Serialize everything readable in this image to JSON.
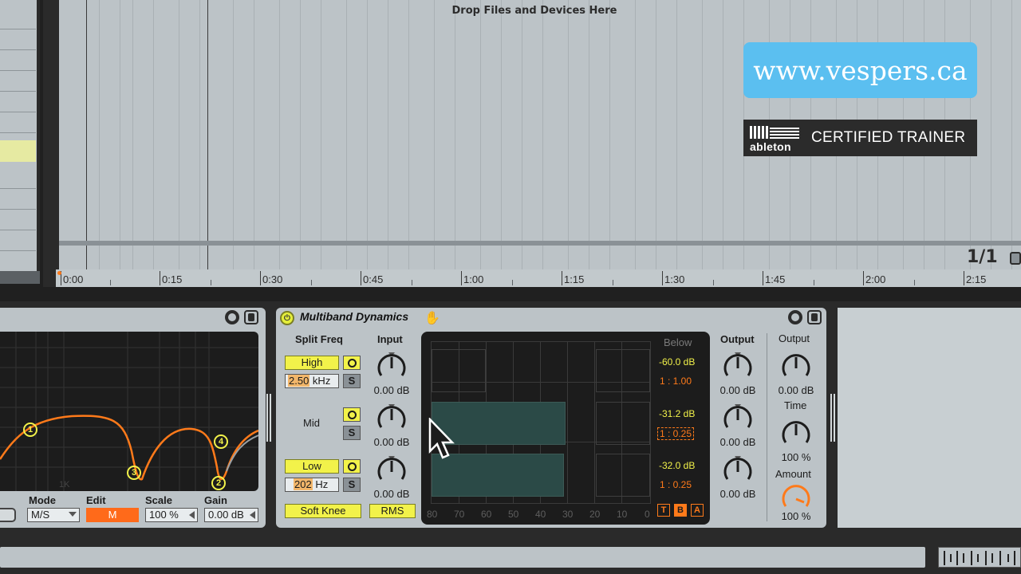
{
  "arrangement": {
    "drop_hint": "Drop Files and Devices Here",
    "loop_count": "1/1",
    "ruler_labels": [
      "0:00",
      "0:15",
      "0:30",
      "0:45",
      "1:00",
      "1:15",
      "1:30",
      "1:45",
      "2:00",
      "2:15"
    ]
  },
  "branding": {
    "website": "www.vespers.ca",
    "logo_word": "ableton",
    "certified": "CERTIFIED TRAINER"
  },
  "eq_device": {
    "mode_label": "Mode",
    "mode_value": "M/S",
    "edit_label": "Edit",
    "edit_value": "M",
    "scale_label": "Scale",
    "scale_value": "100 %",
    "gain_label": "Gain",
    "gain_value": "0.00 dB",
    "graph_freq_label": "1K",
    "band_markers": [
      "1",
      "3",
      "4",
      "2"
    ]
  },
  "multiband": {
    "title": "Multiband Dynamics",
    "split_freq_label": "Split Freq",
    "input_label": "Input",
    "output_label": "Output",
    "output2_label": "Output",
    "time_label": "Time",
    "amount_label": "Amount",
    "high_label": "High",
    "high_freq": "2.50 kHz",
    "high_freq_highlight": "2.50",
    "high_freq_unit": " kHz",
    "mid_label": "Mid",
    "low_label": "Low",
    "low_freq_highlight": "202",
    "low_freq_unit": " Hz",
    "solo_label": "S",
    "soft_knee_label": "Soft Knee",
    "rms_label": "RMS",
    "input_values": [
      "0.00 dB",
      "0.00 dB",
      "0.00 dB"
    ],
    "output_values": [
      "0.00 dB",
      "0.00 dB",
      "0.00 dB"
    ],
    "master_output_value": "0.00 dB",
    "time_value": "100 %",
    "amount_value": "100 %",
    "below_label": "Below",
    "thresholds": [
      "-60.0 dB",
      "-31.2 dB",
      "-32.0 dB"
    ],
    "ratios": [
      "1 : 1.00",
      "1 : 0.25",
      "1 : 0.25"
    ],
    "scale": [
      "80",
      "70",
      "60",
      "50",
      "40",
      "30",
      "20",
      "10",
      "0"
    ],
    "tba": [
      "T",
      "B",
      "A"
    ],
    "colors": {
      "accent_yellow": "#f2f24a",
      "accent_orange": "#ff7a1a",
      "band_fill": "#2b4a47"
    }
  }
}
